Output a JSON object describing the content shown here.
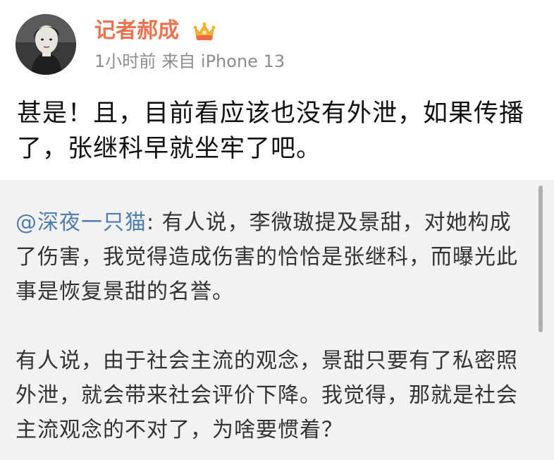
{
  "post": {
    "author": {
      "name": "记者郝成",
      "badge_icon": "crown-icon",
      "badge_colors": {
        "crown": "#f5b233",
        "ribbon": "#ea6a4a"
      }
    },
    "meta": {
      "time": "1小时前",
      "source": "来自 iPhone 13"
    },
    "text": "甚是！且，目前看应该也没有外泄，如果传播了，张继科早就坐牢了吧。"
  },
  "repost": {
    "author": "@深夜一只猫",
    "separator": ": ",
    "paragraph1": "有人说，李微璈提及景甜，对她构成了伤害，我觉得造成伤害的恰恰是张继科，而曝光此事是恢复景甜的名誉。",
    "paragraph2": "有人说，由于社会主流的观念，景甜只要有了私密照外泄，就会带来社会评价下降。我觉得，那就是社会主流观念的不对了，为啥要惯着？"
  },
  "colors": {
    "username": "#eb7350",
    "meta": "#8d8d8d",
    "link": "#507daf",
    "repost_background": "#f2f2f2"
  }
}
